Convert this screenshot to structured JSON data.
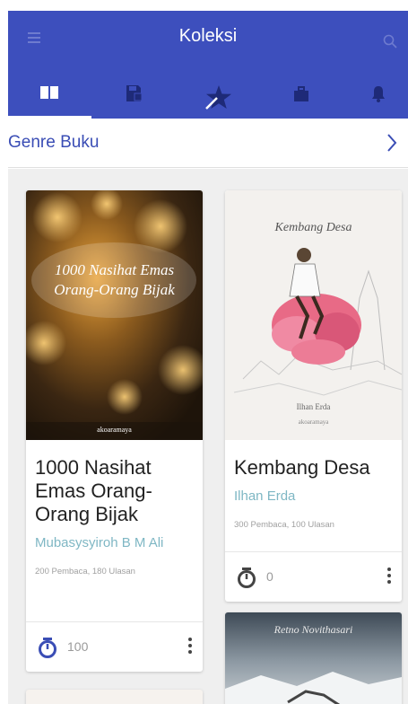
{
  "appbar": {
    "title": "Koleksi"
  },
  "genre": {
    "title": "Genre Buku"
  },
  "books": [
    {
      "title": "1000 Nasihat Emas Orang-Orang Bijak",
      "title_lines": [
        "1000 Nasihat",
        "Emas Orang-",
        "Orang Bijak"
      ],
      "author": "Mubasysyiroh B M Ali",
      "stats": "200 Pembaca, 180 Ulasan",
      "timer": "100",
      "cover_title_lines": [
        "1000 Nasihat Emas",
        "Orang-Orang Bijak"
      ],
      "cover_publisher": "akoaramaya"
    },
    {
      "title": "Kembang Desa",
      "title_lines": [
        "Kembang Desa"
      ],
      "author": "Ilhan Erda",
      "stats": "300 Pembaca, 100 Ulasan",
      "timer": "0",
      "cover_title": "Kembang Desa",
      "cover_author": "Ilhan Erda",
      "cover_publisher": "akoaramaya"
    },
    {
      "cover_author": "Retno Novithasari"
    }
  ],
  "colors": {
    "primary": "#3d4fbd",
    "accent_text": "#3a4db5",
    "author": "#7fb7c4",
    "background": "#efefef"
  },
  "icons": {
    "menu": "menu-icon",
    "search": "search-icon",
    "tabs": [
      "book-open-icon",
      "save-icon",
      "star-icon",
      "briefcase-icon",
      "bell-icon"
    ],
    "chevron": "chevron-right-icon",
    "timer": "timer-icon",
    "more": "more-vertical-icon"
  }
}
